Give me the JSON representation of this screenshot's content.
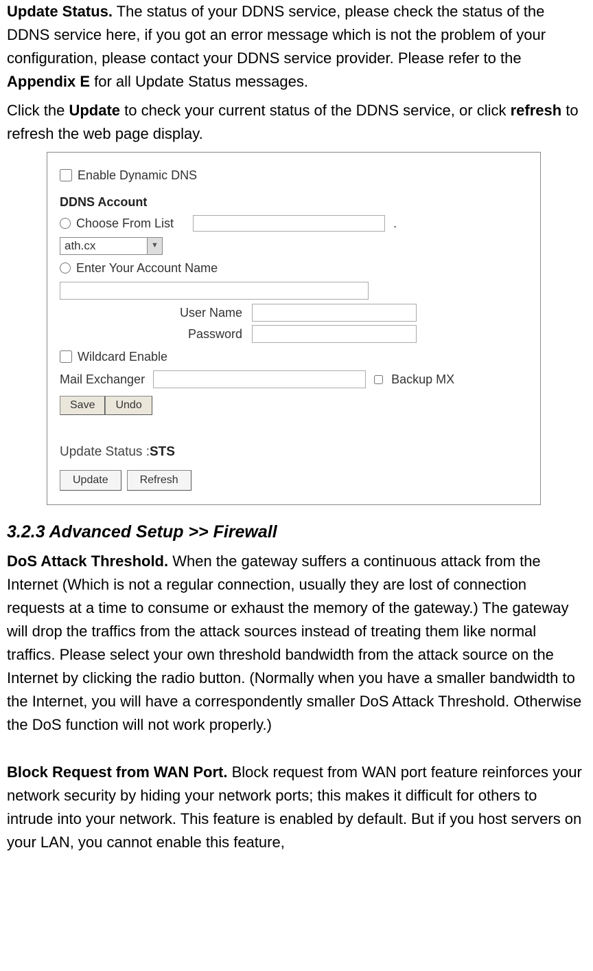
{
  "intro": {
    "line1_bold": "Update Status.",
    "line1_rest": " The status of your DDNS service, please check the status of the DDNS service here, if you got an error message which is not the problem of your configuration, please contact your DDNS service provider. Please refer to the ",
    "line1_bold2": "Appendix E",
    "line1_rest2": " for all Update Status messages.",
    "line2_a": "Click the ",
    "line2_bold1": "Update",
    "line2_b": " to check your current status of the DDNS service, or click ",
    "line2_bold2": "refresh",
    "line2_c": " to refresh the web page display."
  },
  "panel": {
    "enable_ddns": "Enable Dynamic DNS",
    "account_heading": "DDNS Account",
    "choose_from_list": "Choose From List",
    "dropdown_value": "ath.cx",
    "enter_account": "Enter Your Account Name",
    "user_name": "User Name",
    "password": "Password",
    "wildcard": "Wildcard Enable",
    "mail_exchanger": "Mail Exchanger",
    "backup_mx": "Backup MX",
    "save": "Save",
    "undo": "Undo",
    "update_status_label": "Update Status :",
    "sts": "STS",
    "update": "Update",
    "refresh": "Refresh"
  },
  "section": {
    "heading": "3.2.3 Advanced Setup >> Firewall",
    "p1_bold": "DoS Attack Threshold.",
    "p1_rest": " When the gateway suffers a continuous attack from the Internet (Which is not a regular connection, usually they are lost of connection requests at a time to consume or exhaust the memory of the gateway.) The gateway will drop the traffics from the attack sources instead of treating them like normal traffics. Please select your own threshold bandwidth from the attack source on the Internet by clicking the radio button. (Normally when you have a smaller bandwidth to the Internet, you will have a correspondently smaller DoS Attack Threshold. Otherwise the DoS function will not work properly.)",
    "p2_bold": "Block Request from WAN Port.",
    "p2_rest": " Block request from WAN port feature reinforces your network security by hiding your network ports; this makes it difficult for others to intrude into your network. This feature is enabled by default. But if you host servers on your LAN, you cannot enable this feature,"
  }
}
